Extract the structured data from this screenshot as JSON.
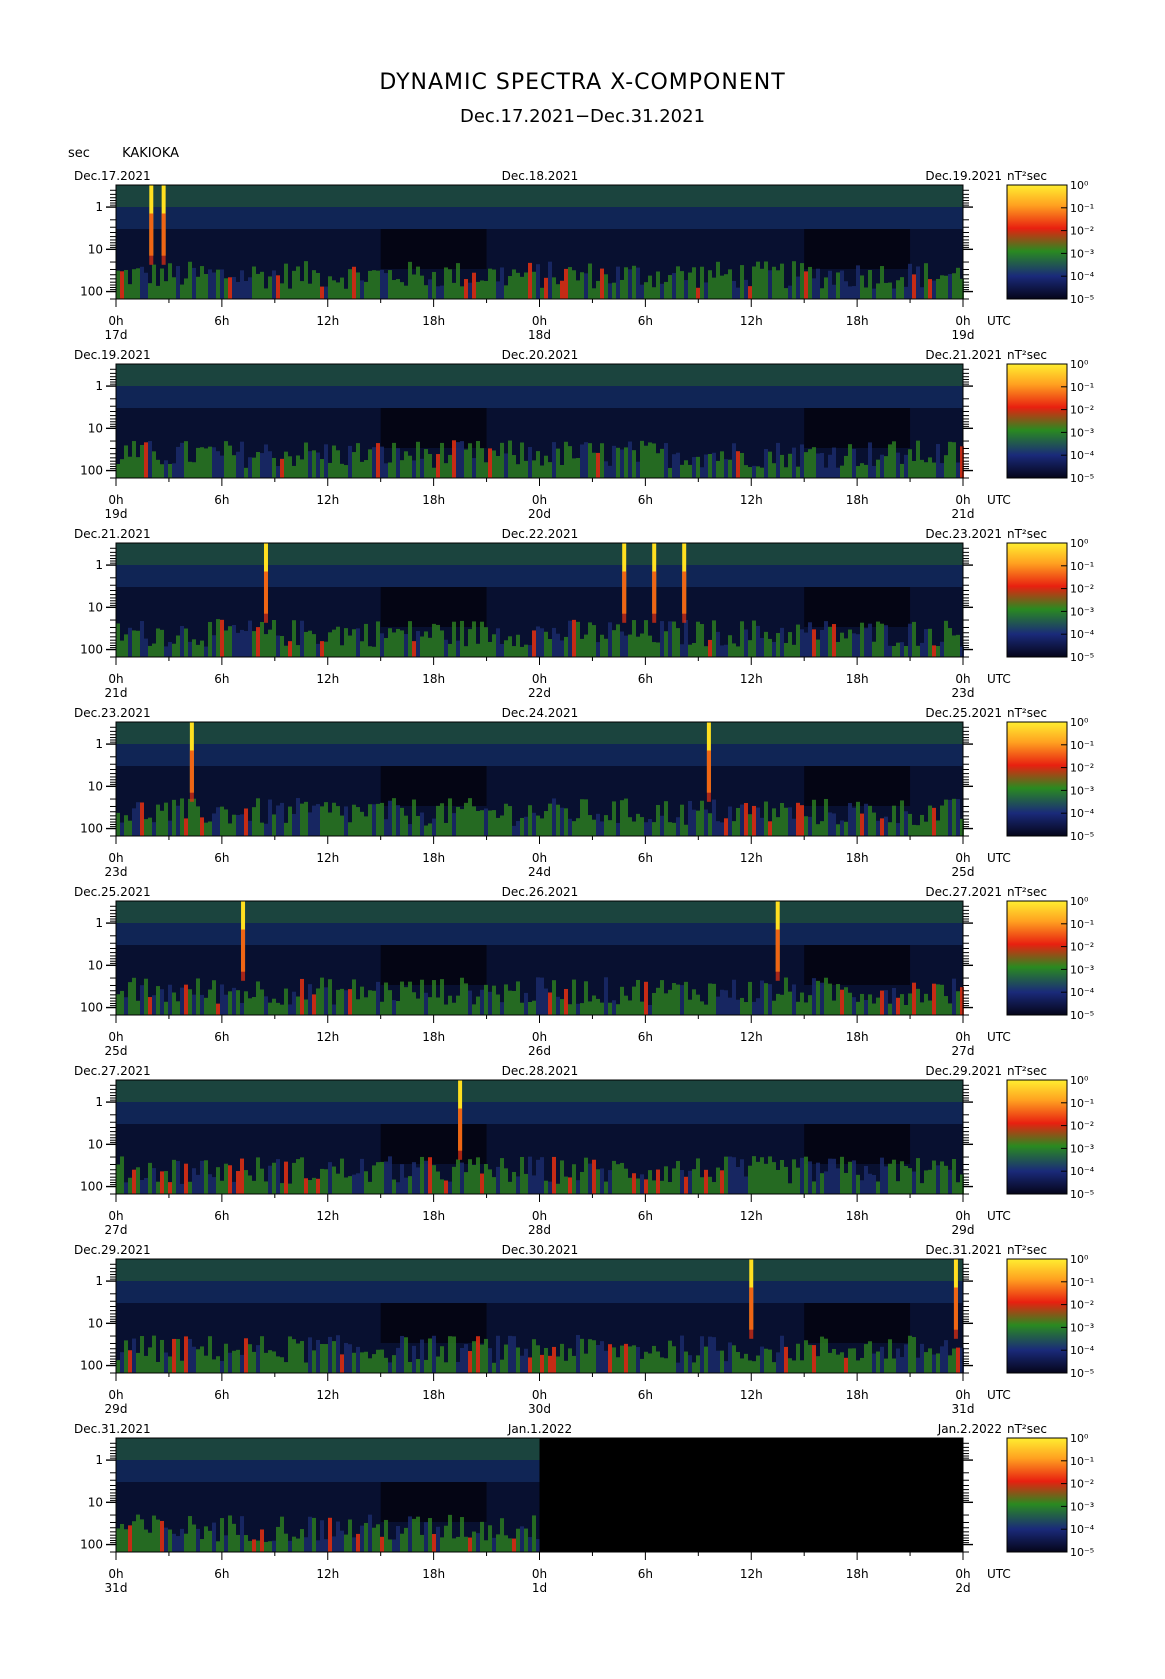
{
  "header": {
    "title": "DYNAMIC SPECTRA X-COMPONENT",
    "subtitle": "Dec.17.2021−Dec.31.2021",
    "y_unit": "sec",
    "station": "KAKIOKA"
  },
  "colors": {
    "background_low": "#0a0a2a",
    "blue": "#1a2a6a",
    "green": "#2a7a20",
    "red": "#e83010",
    "yellow": "#ffe020"
  },
  "chart_data": {
    "type": "heatmap",
    "title": "DYNAMIC SPECTRA X-COMPONENT",
    "subtitle": "Dec.17.2021−Dec.31.2021",
    "ylabel": "sec",
    "y_scale": "log",
    "y_ticks": [
      "1",
      "10",
      "100"
    ],
    "x_ticks": [
      "0h",
      "6h",
      "12h",
      "18h",
      "0h",
      "6h",
      "12h",
      "18h",
      "0h"
    ],
    "x_unit": "UTC",
    "colorbar": {
      "unit": "nT²sec",
      "labels": [
        "10⁰",
        "10⁻¹",
        "10⁻²",
        "10⁻³",
        "10⁻⁴",
        "10⁻⁵"
      ]
    },
    "panels": [
      {
        "left_date": "Dec.17.2021",
        "mid_date": "Dec.18.2021",
        "right_date": "Dec.19.2021",
        "day_labels": [
          "17d",
          "18d",
          "19d"
        ],
        "spikes_hours": [
          2.0,
          2.7
        ],
        "data_end_hour": 48
      },
      {
        "left_date": "Dec.19.2021",
        "mid_date": "Dec.20.2021",
        "right_date": "Dec.21.2021",
        "day_labels": [
          "19d",
          "20d",
          "21d"
        ],
        "spikes_hours": [],
        "data_end_hour": 48
      },
      {
        "left_date": "Dec.21.2021",
        "mid_date": "Dec.22.2021",
        "right_date": "Dec.23.2021",
        "day_labels": [
          "21d",
          "22d",
          "23d"
        ],
        "spikes_hours": [
          8.5,
          28.8,
          30.5,
          32.2
        ],
        "data_end_hour": 48
      },
      {
        "left_date": "Dec.23.2021",
        "mid_date": "Dec.24.2021",
        "right_date": "Dec.25.2021",
        "day_labels": [
          "23d",
          "24d",
          "25d"
        ],
        "spikes_hours": [
          4.3,
          33.6
        ],
        "data_end_hour": 48
      },
      {
        "left_date": "Dec.25.2021",
        "mid_date": "Dec.26.2021",
        "right_date": "Dec.27.2021",
        "day_labels": [
          "25d",
          "26d",
          "27d"
        ],
        "spikes_hours": [
          7.2,
          37.5
        ],
        "data_end_hour": 48
      },
      {
        "left_date": "Dec.27.2021",
        "mid_date": "Dec.28.2021",
        "right_date": "Dec.29.2021",
        "day_labels": [
          "27d",
          "28d",
          "29d"
        ],
        "spikes_hours": [
          19.5
        ],
        "data_end_hour": 48
      },
      {
        "left_date": "Dec.29.2021",
        "mid_date": "Dec.30.2021",
        "right_date": "Dec.31.2021",
        "day_labels": [
          "29d",
          "30d",
          "31d"
        ],
        "spikes_hours": [
          36.0,
          47.6
        ],
        "data_end_hour": 48
      },
      {
        "left_date": "Dec.31.2021",
        "mid_date": "Jan.1.2022",
        "right_date": "Jan.2.2022",
        "day_labels": [
          "31d",
          "1d",
          "2d"
        ],
        "spikes_hours": [],
        "data_end_hour": 24
      }
    ]
  }
}
